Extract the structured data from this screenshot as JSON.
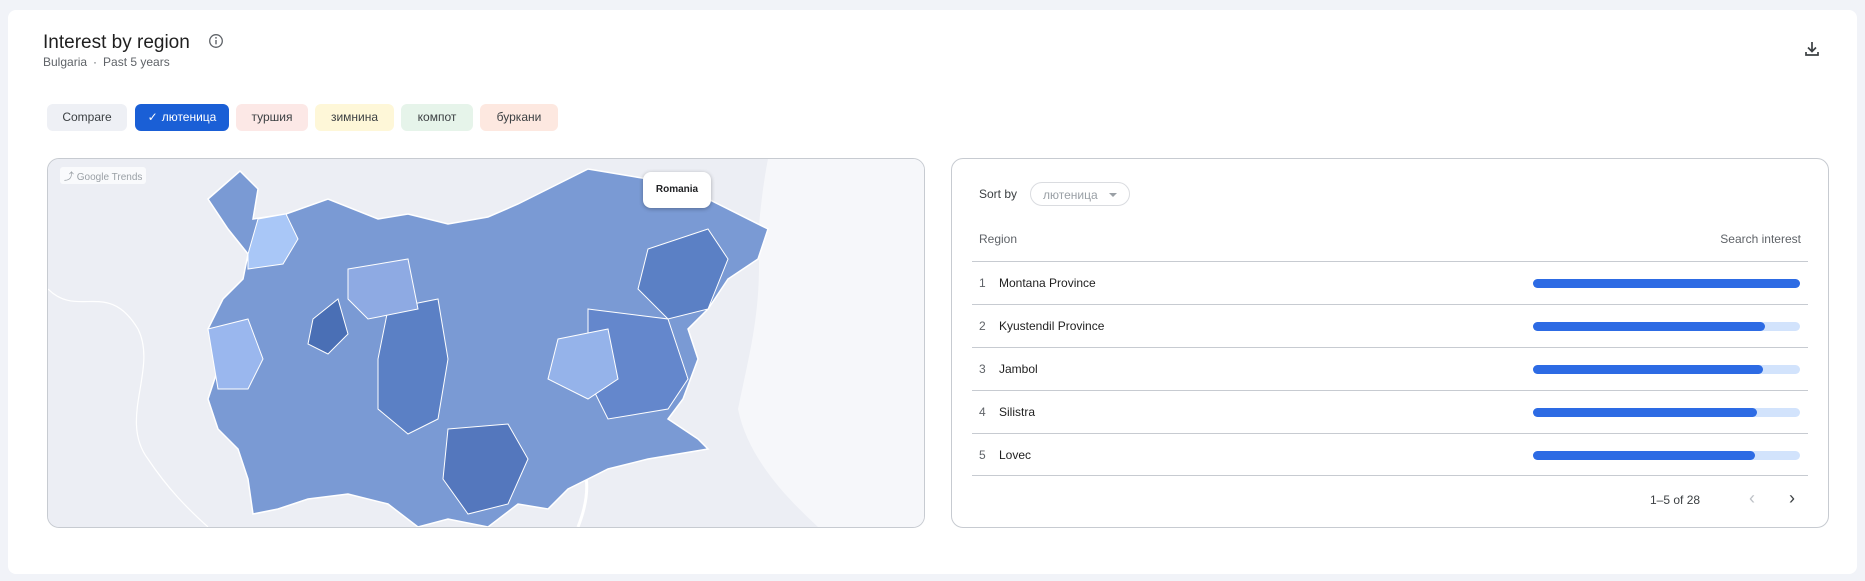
{
  "header": {
    "title": "Interest by region",
    "location": "Bulgaria",
    "separator": "·",
    "period": "Past 5 years"
  },
  "chips": [
    {
      "label": "Compare",
      "color": "#eef0f5",
      "selected": false
    },
    {
      "label": "лютеница",
      "color": "#1a5fd6",
      "selected": true
    },
    {
      "label": "туршия",
      "color": "#fce8e6",
      "selected": false
    },
    {
      "label": "зимнина",
      "color": "#fef7d8",
      "selected": false
    },
    {
      "label": "компот",
      "color": "#e6f4ea",
      "selected": false
    },
    {
      "label": "буркани",
      "color": "#fde8e0",
      "selected": false
    }
  ],
  "map": {
    "watermark": "Google Trends",
    "tooltip": "Romania"
  },
  "table": {
    "sort_label": "Sort by",
    "sort_value": "лютеница",
    "col_region": "Region",
    "col_interest": "Search interest",
    "rows": [
      {
        "rank": "1",
        "name": "Montana Province",
        "value": 100
      },
      {
        "rank": "2",
        "name": "Kyustendil Province",
        "value": 87
      },
      {
        "rank": "3",
        "name": "Jambol",
        "value": 86
      },
      {
        "rank": "4",
        "name": "Silistra",
        "value": 84
      },
      {
        "rank": "5",
        "name": "Lovec",
        "value": 83
      }
    ],
    "pager": "1–5 of 28"
  },
  "colors": {
    "accent": "#1a5fd6",
    "bar": "#2d6be4",
    "bar_track": "#d2e3fc"
  }
}
